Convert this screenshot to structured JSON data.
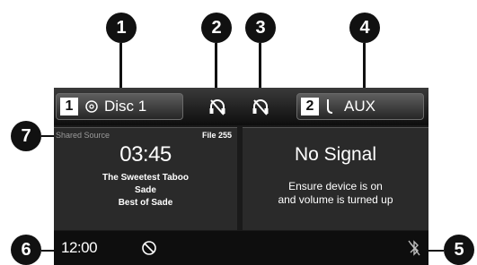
{
  "callouts": [
    "1",
    "2",
    "3",
    "4",
    "5",
    "6",
    "7"
  ],
  "topbar": {
    "source1": {
      "number": "1",
      "icon": "disc-icon",
      "label": "Disc 1"
    },
    "source2": {
      "number": "2",
      "icon": "aux-plug-icon",
      "label": "AUX"
    },
    "headphone_icons": [
      "headphone-off-icon",
      "headphone-off-icon"
    ]
  },
  "left_panel": {
    "shared_source": "Shared Source",
    "file": "File 255",
    "time": "03:45",
    "track": "The Sweetest Taboo",
    "artist": "Sade",
    "album": "Best of Sade"
  },
  "right_panel": {
    "status": "No Signal",
    "message_line1": "Ensure device is on",
    "message_line2": "and volume is turned up"
  },
  "bottombar": {
    "clock": "12:00",
    "left_icon": "no-entry-icon",
    "right_icon": "bluetooth-off-icon"
  },
  "colors": {
    "screen_bg": "#1a1a1a",
    "panel_bg": "#2a2a2a",
    "text": "#ffffff",
    "subtle": "#9a9a9a"
  }
}
